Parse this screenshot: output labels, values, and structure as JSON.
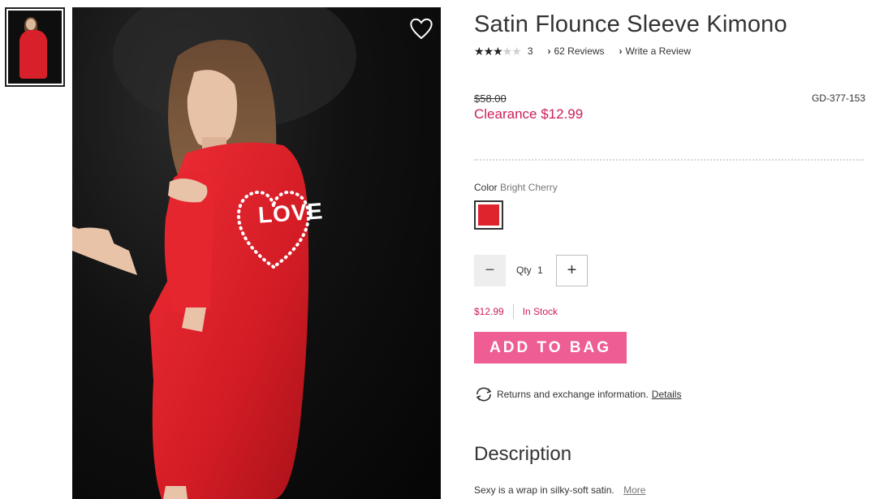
{
  "product": {
    "title": "Satin Flounce Sleeve Kimono",
    "rating_stars": 3,
    "rating_max": 5,
    "rating_count": "3",
    "reviews_link": "62 Reviews",
    "write_review_link": "Write a Review",
    "price_original": "$58.00",
    "price_clearance": "Clearance $12.99",
    "sku": "GD-377-153"
  },
  "color": {
    "label": "Color",
    "value": "Bright Cherry",
    "swatch_hex": "#e0242e"
  },
  "quantity": {
    "label": "Qty",
    "value": "1",
    "minus_symbol": "−",
    "plus_symbol": "+"
  },
  "availability": {
    "price": "$12.99",
    "stock": "In Stock"
  },
  "cart": {
    "add_label": "ADD TO BAG"
  },
  "returns": {
    "text": "Returns and exchange information.",
    "details_link": "Details"
  },
  "description": {
    "heading": "Description",
    "text": "Sexy is a wrap in silky-soft satin.",
    "more_link": "More"
  },
  "image_graphic": {
    "back_print": "LOVE"
  },
  "icons": {
    "wishlist": "heart-outline-icon",
    "returns": "exchange-arrows-icon",
    "chevron": "chevron-right-icon"
  },
  "colors": {
    "accent_pink": "#ee5d94",
    "price_red": "#cc1f57"
  }
}
